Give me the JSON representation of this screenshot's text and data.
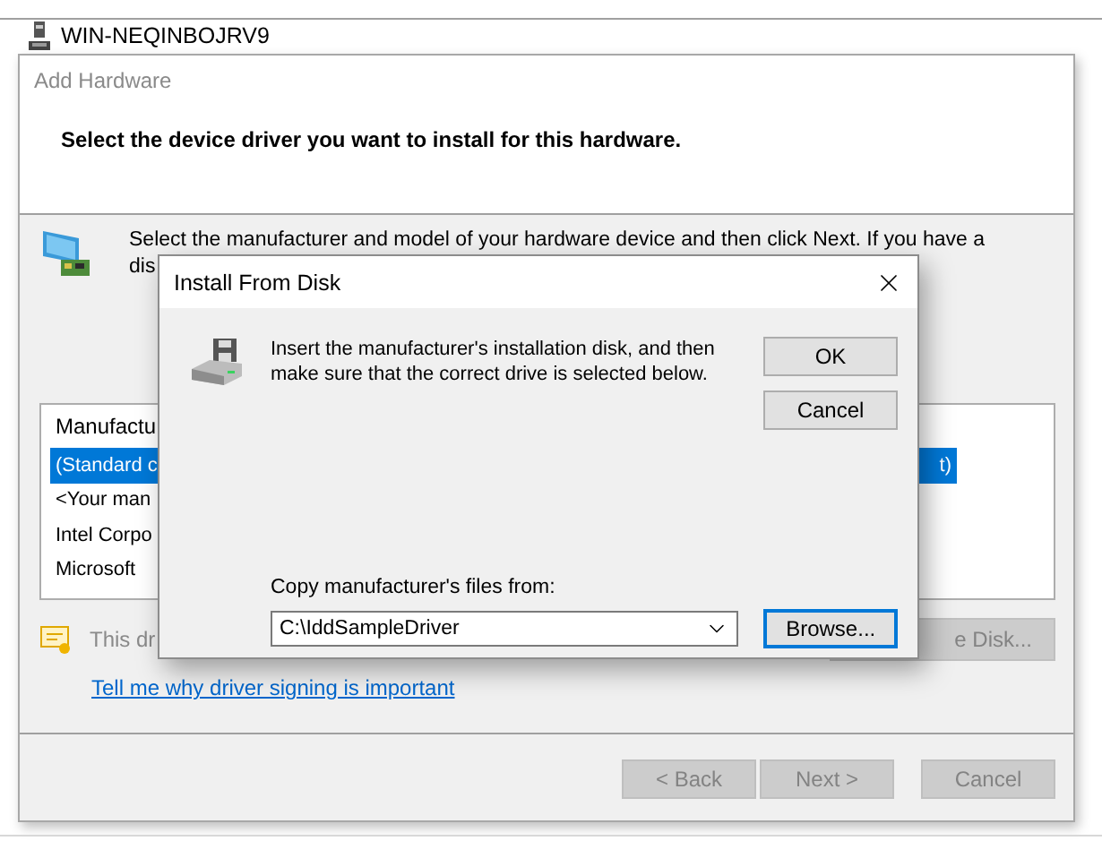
{
  "background": {
    "tree_item": "WIN-NEQINBOJRV9"
  },
  "wizard": {
    "title": "Add Hardware",
    "heading": "Select the device driver you want to install for this hardware.",
    "intro_lines": [
      "Select the manufacturer and model of your hardware device and then click Next. If you have a",
      "dis"
    ],
    "list": {
      "header": "Manufactu",
      "rows": [
        {
          "text": "(Standard c",
          "trailing": "t)",
          "selected": true
        },
        {
          "text": "<Your man",
          "selected": false
        },
        {
          "text": "Intel Corpo",
          "selected": false
        },
        {
          "text": "Microsoft",
          "selected": false
        }
      ]
    },
    "signing_note": "This dr",
    "have_disk_button": {
      "label": "e Disk...",
      "disabled": true
    },
    "link": "Tell me why driver signing is important",
    "buttons": [
      {
        "label": "< Back",
        "disabled": true
      },
      {
        "label": "Next >",
        "disabled": true
      },
      {
        "label": "Cancel",
        "disabled": true
      }
    ]
  },
  "dialog": {
    "title": "Install From Disk",
    "message": "Insert the manufacturer's installation disk, and then make sure that the correct drive is selected below.",
    "ok_button": {
      "label": "OK",
      "focused": false
    },
    "cancel_button": {
      "label": "Cancel",
      "focused": false
    },
    "path_label": "Copy manufacturer's files from:",
    "path_value": "C:\\IddSampleDriver",
    "browse_button": {
      "label": "Browse...",
      "focused": true
    }
  }
}
